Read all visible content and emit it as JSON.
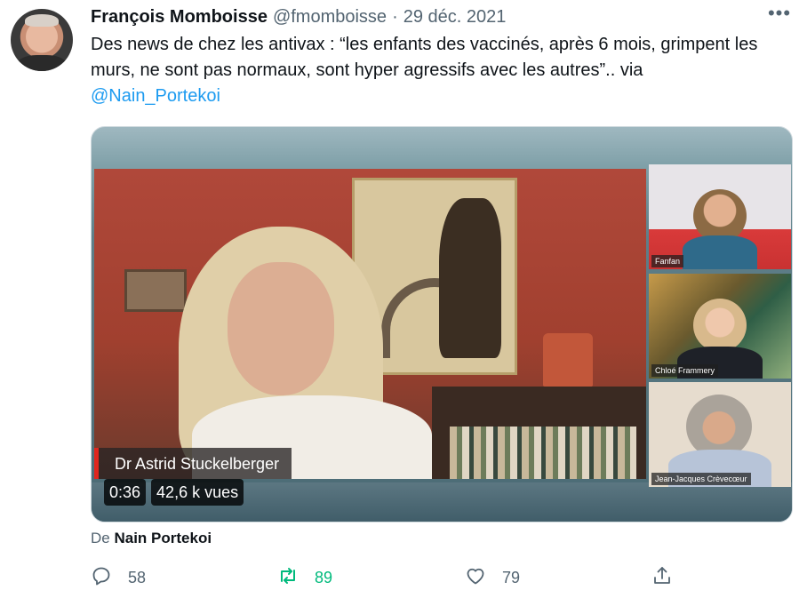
{
  "tweet": {
    "author_name": "François Momboisse",
    "author_handle": "@fmomboisse",
    "separator": "·",
    "date": "29 déc. 2021",
    "more_label": "•••",
    "text": "Des news de chez les antivax : “les enfants des vaccinés, après 6 mois, grimpent les murs, ne sont pas normaux, sont hyper agressifs avec les autres”.. via",
    "mention": "@Nain_Portekoi"
  },
  "video": {
    "main_speaker": "Dr Astrid Stuckelberger",
    "duration": "0:36",
    "views": "42,6 k vues",
    "participants": [
      {
        "name": "Fanfan"
      },
      {
        "name": "Chloé Frammery"
      },
      {
        "name": "Jean-Jacques Crèvecœur"
      }
    ]
  },
  "source": {
    "prefix": "De",
    "name": "Nain Portekoi"
  },
  "actions": {
    "replies": "58",
    "retweets": "89",
    "likes": "79"
  },
  "colors": {
    "link": "#1d9bf0",
    "retweet_active": "#00ba7c",
    "secondary_text": "#536471"
  }
}
